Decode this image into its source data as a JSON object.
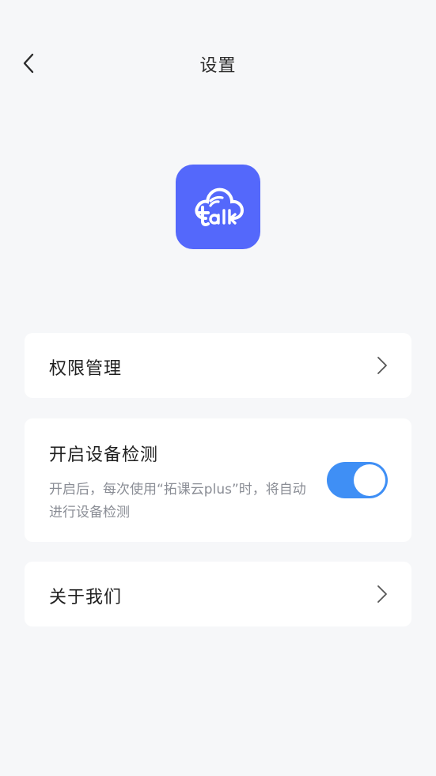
{
  "header": {
    "title": "设置",
    "back_icon": "chevron-left-icon"
  },
  "logo": {
    "icon": "talk-cloud-logo",
    "brand_color": "#5468fb"
  },
  "settings": {
    "permissions": {
      "label": "权限管理",
      "icon": "chevron-right-icon"
    },
    "device_detection": {
      "label": "开启设备检测",
      "description": "开启后，每次使用“拓课云plus”时，将自动进行设备检测",
      "enabled": true,
      "toggle_color": "#3f8ff5"
    },
    "about": {
      "label": "关于我们",
      "icon": "chevron-right-icon"
    }
  }
}
